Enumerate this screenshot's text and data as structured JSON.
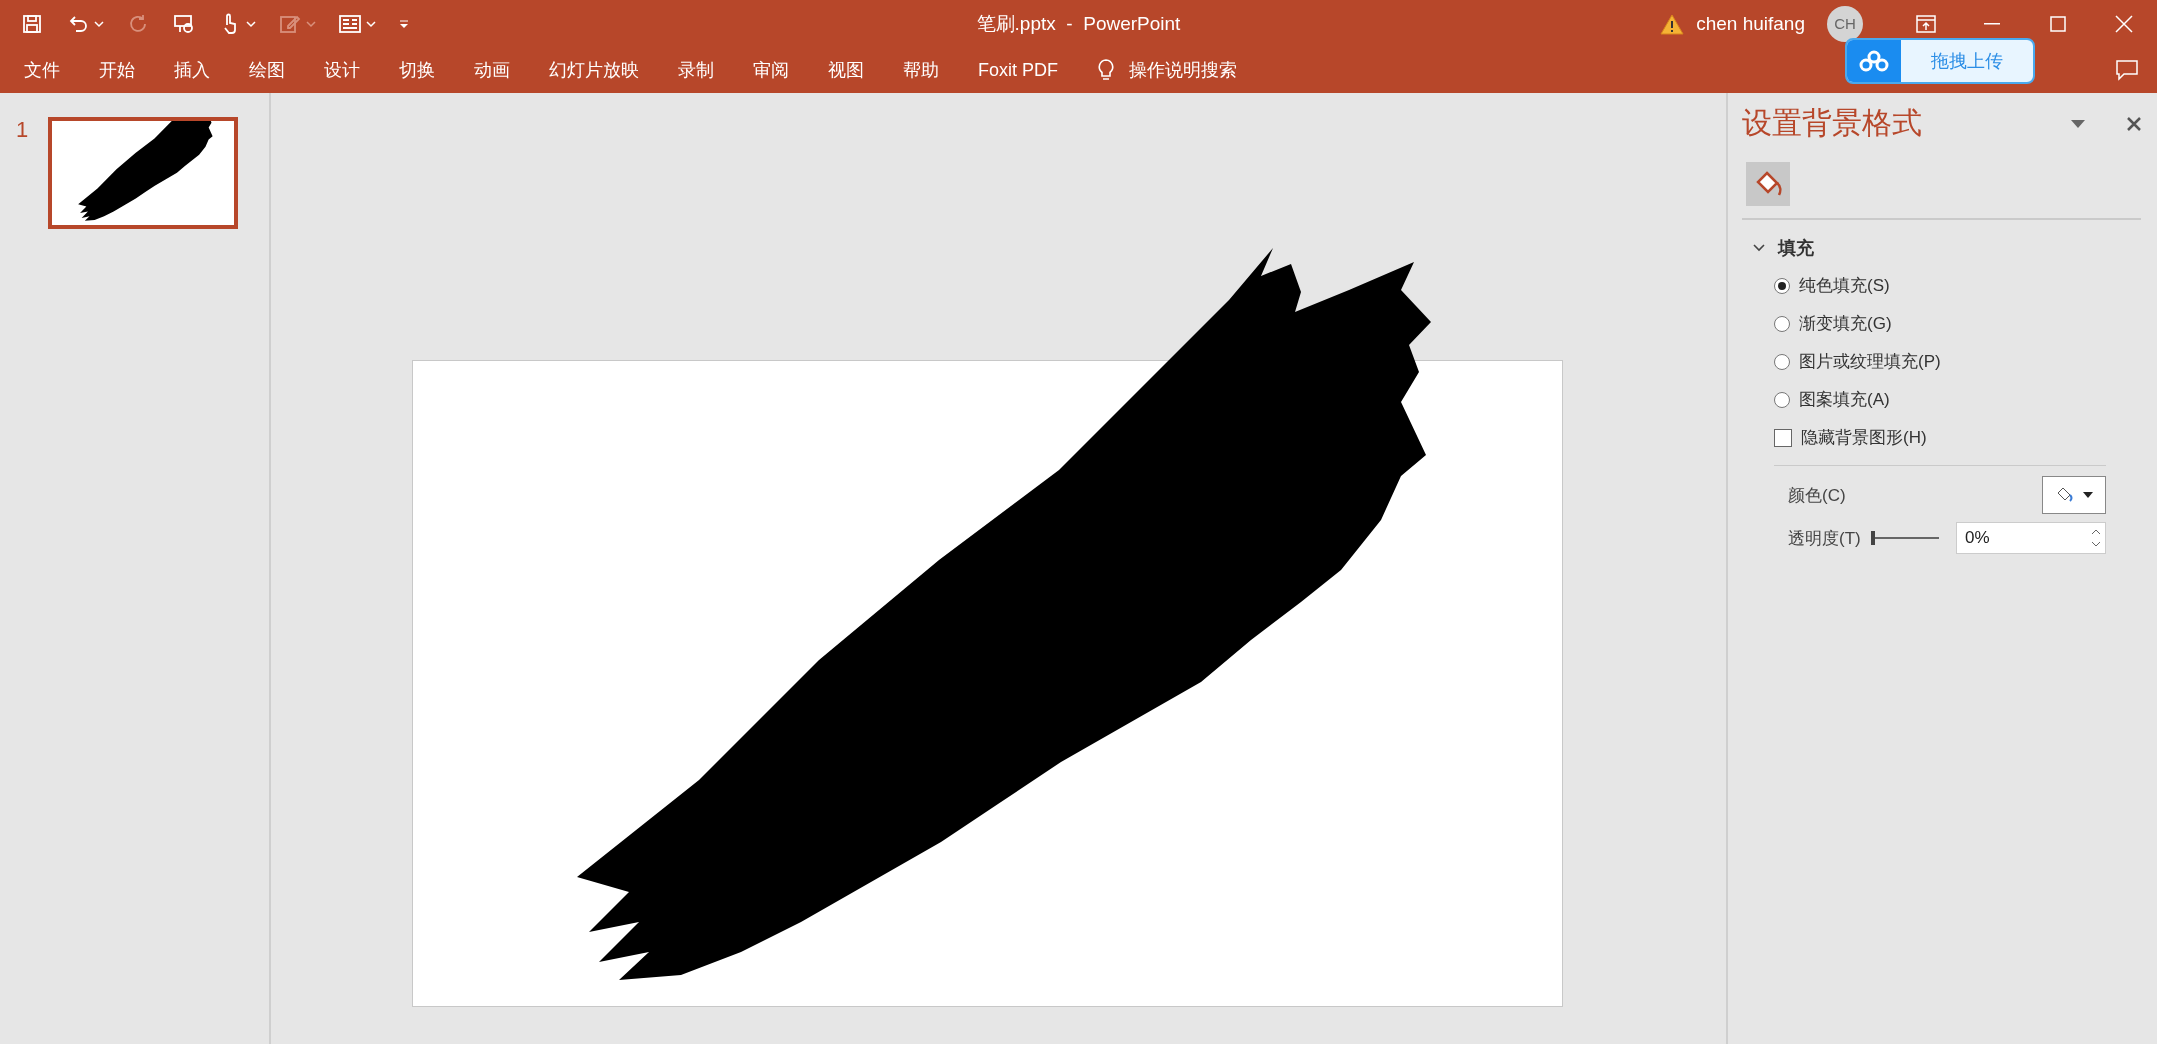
{
  "quick_access": [
    {
      "kind": "save",
      "disabled": false,
      "caret": false
    },
    {
      "kind": "undo",
      "disabled": false,
      "caret": true
    },
    {
      "kind": "redo",
      "disabled": true,
      "caret": false
    },
    {
      "kind": "present",
      "disabled": false,
      "caret": false
    },
    {
      "kind": "touch",
      "disabled": false,
      "caret": true
    },
    {
      "kind": "pen",
      "disabled": true,
      "caret": true
    },
    {
      "kind": "layout",
      "disabled": false,
      "caret": true
    },
    {
      "kind": "customize",
      "disabled": false,
      "caret": false
    }
  ],
  "window": {
    "title": "笔刷.pptx  -  PowerPoint",
    "user": "chen huifang",
    "avatar": "CH"
  },
  "upload_button": "拖拽上传",
  "menu": [
    "文件",
    "开始",
    "插入",
    "绘图",
    "设计",
    "切换",
    "动画",
    "幻灯片放映",
    "录制",
    "审阅",
    "视图",
    "帮助",
    "Foxit PDF"
  ],
  "tell_me": "操作说明搜索",
  "slides": [
    {
      "number": "1",
      "selected": true
    }
  ],
  "pane": {
    "title": "设置背景格式",
    "section": {
      "title": "填充",
      "expanded": true
    },
    "options": [
      {
        "label": "纯色填充(S)",
        "selected": true
      },
      {
        "label": "渐变填充(G)",
        "selected": false
      },
      {
        "label": "图片或纹理填充(P)",
        "selected": false
      },
      {
        "label": "图案填充(A)",
        "selected": false
      }
    ],
    "checkbox": {
      "label": "隐藏背景图形(H)",
      "checked": false
    },
    "color_label": "颜色(C)",
    "transparency": {
      "label": "透明度(T)",
      "level": 0,
      "value": "0%"
    }
  }
}
